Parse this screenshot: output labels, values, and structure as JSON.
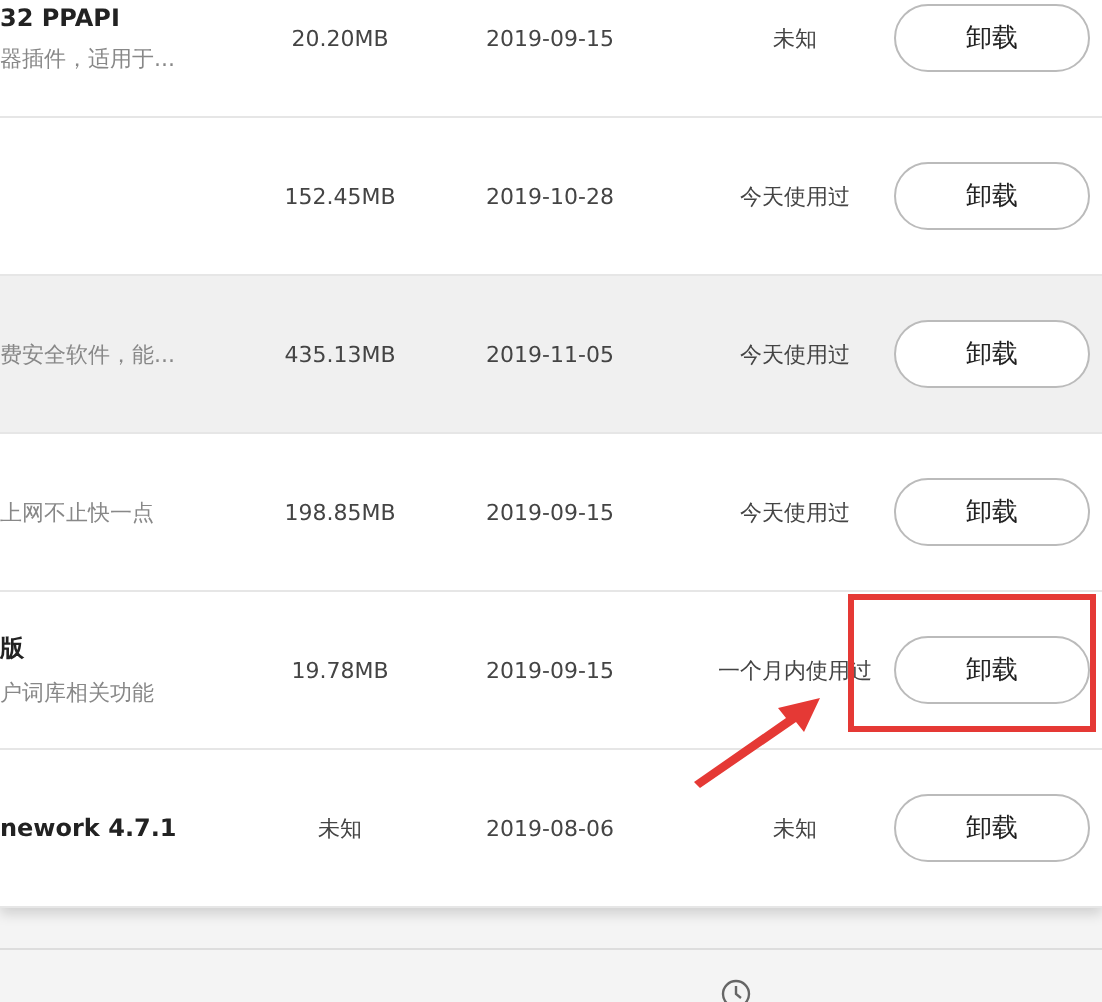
{
  "rows": [
    {
      "name": "32 PPAPI",
      "description": "器插件，适用于...",
      "size": "20.20MB",
      "date": "2019-09-15",
      "usage": "未知",
      "button": "卸载",
      "selected": false,
      "highlighted": false
    },
    {
      "size": "152.45MB",
      "date": "2019-10-28",
      "usage": "今天使用过",
      "button": "卸载",
      "selected": false,
      "highlighted": false
    },
    {
      "description": "费安全软件，能...",
      "size": "435.13MB",
      "date": "2019-11-05",
      "usage": "今天使用过",
      "button": "卸载",
      "selected": true,
      "highlighted": false
    },
    {
      "description": "上网不止快一点",
      "size": "198.85MB",
      "date": "2019-09-15",
      "usage": "今天使用过",
      "button": "卸载",
      "selected": false,
      "highlighted": false
    },
    {
      "name": "版",
      "description": "户词库相关功能",
      "size": "19.78MB",
      "date": "2019-09-15",
      "usage": "一个月内使用过",
      "button": "卸载",
      "selected": false,
      "highlighted": true
    },
    {
      "name": "nework 4.7.1",
      "size": "未知",
      "date": "2019-08-06",
      "usage": "未知",
      "button": "卸载",
      "selected": false,
      "highlighted": false
    }
  ]
}
